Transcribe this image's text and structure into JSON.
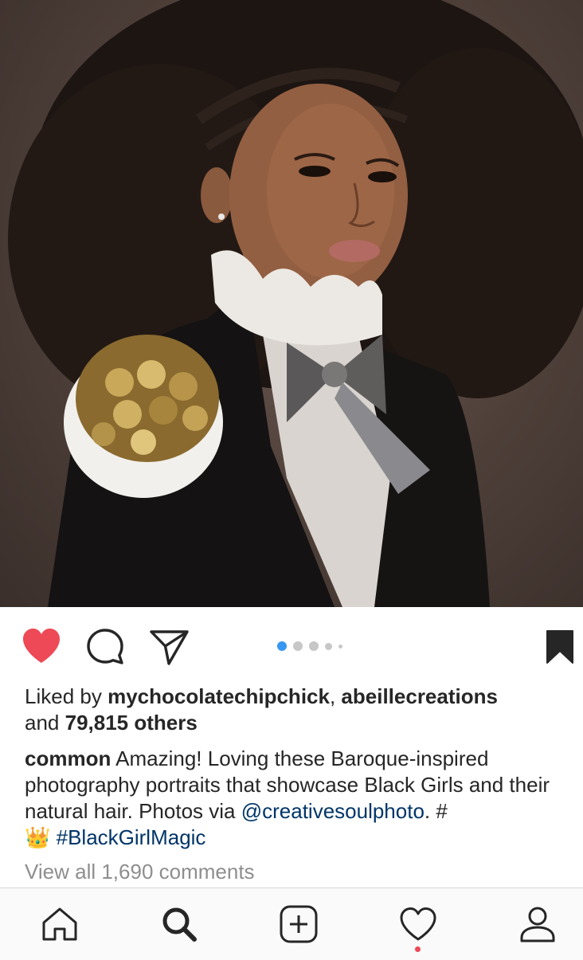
{
  "post": {
    "image_alt": "Portrait of a girl with voluminous natural hair in Baroque-style attire",
    "carousel": {
      "total": 5,
      "active_index": 0
    }
  },
  "actions": {
    "like_icon": "heart-filled-icon",
    "comment_icon": "comment-icon",
    "share_icon": "direct-share-icon",
    "save_icon": "bookmark-filled-icon",
    "like_color": "#ed4956",
    "active_dot_color": "#3897f0"
  },
  "likes": {
    "prefix": "Liked by ",
    "user1": "mychocolatechipchick",
    "separator": ", ",
    "user2": "abeillecreations",
    "and_text": "and ",
    "others": "79,815 others"
  },
  "caption": {
    "username": "common",
    "text_part1": " Amazing! Loving these Baroque-inspired photography portraits that showcase Black Girls and their natural hair. Photos via ",
    "mention": "@creativesoulphoto",
    "text_part2": ". #",
    "emoji": "👑",
    "hashtag": "#BlackGirlMagic"
  },
  "comments": {
    "view_all": "View all 1,690 comments"
  },
  "tabbar": {
    "items": [
      {
        "name": "home",
        "icon": "home-icon"
      },
      {
        "name": "search",
        "icon": "search-icon",
        "active": true
      },
      {
        "name": "new-post",
        "icon": "plus-square-icon"
      },
      {
        "name": "activity",
        "icon": "heart-icon",
        "has_notification": true
      },
      {
        "name": "profile",
        "icon": "profile-icon"
      }
    ]
  }
}
